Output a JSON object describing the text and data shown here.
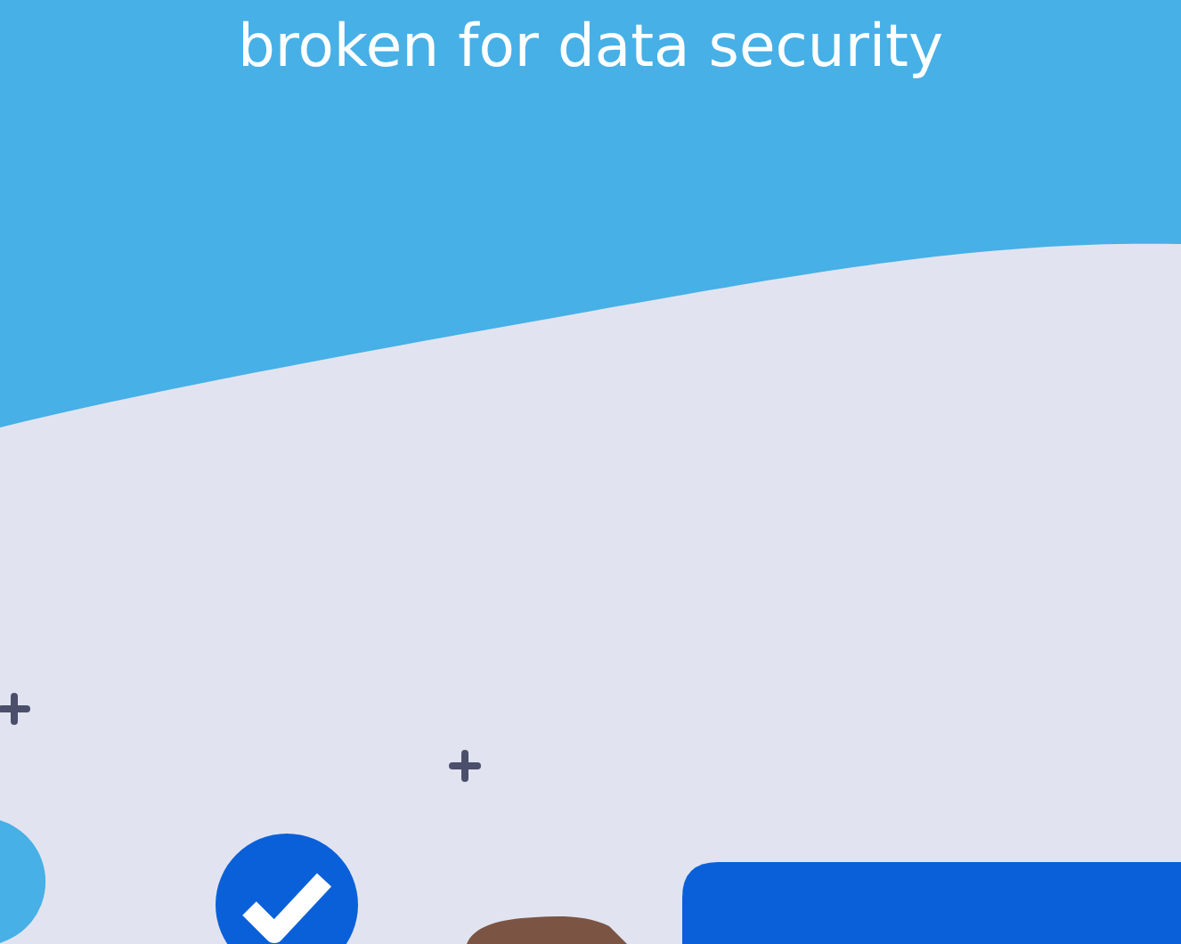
{
  "hero": {
    "headline": "broken for data security"
  }
}
